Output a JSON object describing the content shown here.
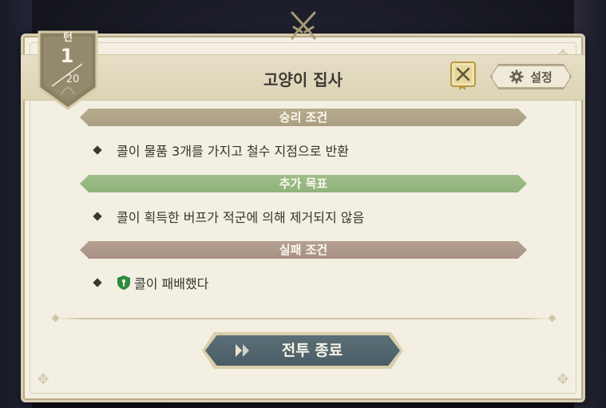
{
  "turn": {
    "label": "턴",
    "current": "1",
    "total": "20"
  },
  "header": {
    "title": "고양이 집사"
  },
  "settings": {
    "label": "설정",
    "icon": "gear-icon"
  },
  "book": {
    "icon": "mission-book-icon"
  },
  "sections": {
    "victory": {
      "title": "승리 조건",
      "condition": "콜이 물품 3개를 가지고 철수 지점으로 반환"
    },
    "extra": {
      "title": "추가 목표",
      "condition": "콜이 획득한 버프가 적군에 의해 제거되지 않음"
    },
    "defeat": {
      "title": "실패 조건",
      "condition": "콜이 패배했다",
      "icon": "ally-shield-icon"
    }
  },
  "end_button": {
    "label": "전투 종료",
    "icon": "double-arrow-icon"
  },
  "colors": {
    "panel": "#f3efe2",
    "victory_banner": "#b6ab8e",
    "extra_banner": "#9fbf8a",
    "defeat_banner": "#b5a092",
    "end_button": "#4a5d66",
    "shield_green": "#2e8a3e"
  }
}
